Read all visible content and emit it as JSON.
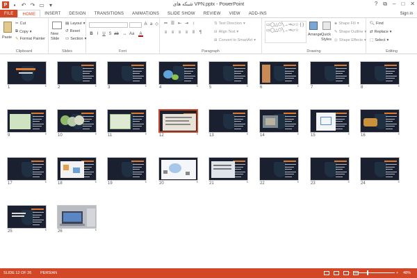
{
  "window": {
    "title": "شبکه های VPN.pptx - PowerPoint",
    "app_icon": "P",
    "minimize": "–",
    "maximize": "□",
    "close": "✕",
    "help": "?",
    "restore": "⧉"
  },
  "tabs": [
    "FILE",
    "HOME",
    "INSERT",
    "DESIGN",
    "TRANSITIONS",
    "ANIMATIONS",
    "SLIDE SHOW",
    "REVIEW",
    "VIEW",
    "ADD-INS"
  ],
  "active_tab": "HOME",
  "sign_in": "Sign in",
  "ribbon": {
    "clipboard": {
      "label": "Clipboard",
      "paste": "Paste",
      "cut": "Cut",
      "copy": "Copy",
      "format_painter": "Format Painter"
    },
    "slides": {
      "label": "Slides",
      "new_slide": "New Slide",
      "layout": "Layout",
      "reset": "Reset",
      "section": "Section"
    },
    "font": {
      "label": "Font"
    },
    "paragraph": {
      "label": "Paragraph",
      "text_direction": "Text Direction",
      "align_text": "Align Text",
      "convert_smartart": "Convert to SmartArt"
    },
    "drawing": {
      "label": "Drawing",
      "arrange": "Arrange",
      "quick_styles": "Quick Styles",
      "shape_fill": "Shape Fill",
      "shape_outline": "Shape Outline",
      "shape_effects": "Shape Effects"
    },
    "editing": {
      "label": "Editing",
      "find": "Find",
      "replace": "Replace",
      "select": "Select"
    }
  },
  "slides": [
    {
      "num": "1"
    },
    {
      "num": "2"
    },
    {
      "num": "3"
    },
    {
      "num": "4"
    },
    {
      "num": "5"
    },
    {
      "num": "6"
    },
    {
      "num": "7"
    },
    {
      "num": "8"
    },
    {
      "num": "9"
    },
    {
      "num": "10"
    },
    {
      "num": "11"
    },
    {
      "num": "12"
    },
    {
      "num": "13"
    },
    {
      "num": "14"
    },
    {
      "num": "15"
    },
    {
      "num": "16"
    },
    {
      "num": "17"
    },
    {
      "num": "18"
    },
    {
      "num": "19"
    },
    {
      "num": "20"
    },
    {
      "num": "21"
    },
    {
      "num": "22"
    },
    {
      "num": "23"
    },
    {
      "num": "24"
    },
    {
      "num": "25"
    },
    {
      "num": "26"
    }
  ],
  "selected_slide": "12",
  "transition_mark": "*",
  "status": {
    "slide_of": "SLIDE 12 OF 26",
    "language": "PERSIAN",
    "zoom_minus": "−",
    "zoom_plus": "+",
    "zoom": "48%"
  },
  "colors": {
    "accent": "#d24726",
    "slide_bg": "#1b2030"
  }
}
